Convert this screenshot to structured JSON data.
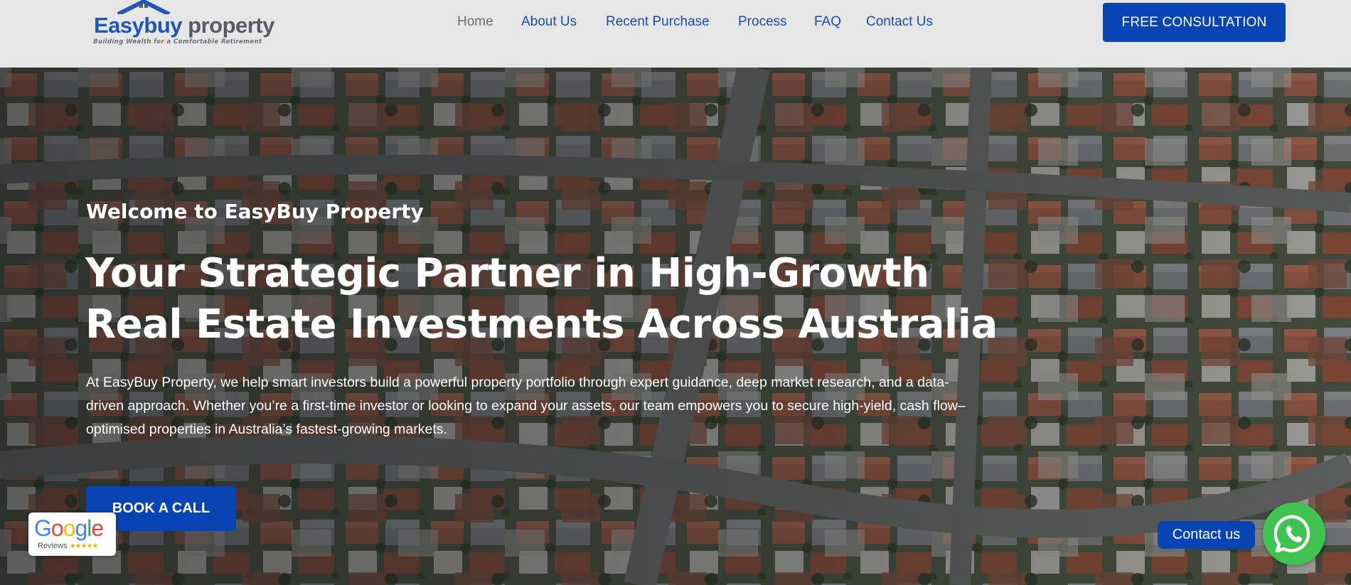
{
  "header": {
    "logo": {
      "brand_part1": "Easybuy",
      "brand_part2": " property",
      "tagline": "Building Wealth for a Comfortable Retirement"
    },
    "nav": [
      {
        "label": "Home",
        "active": true
      },
      {
        "label": "About Us",
        "active": false
      },
      {
        "label": "Recent Purchase",
        "active": false
      },
      {
        "label": "Process",
        "active": false
      },
      {
        "label": "FAQ",
        "active": false
      },
      {
        "label": "Contact Us",
        "active": false
      }
    ],
    "cta_label": "FREE CONSULTATION"
  },
  "hero": {
    "welcome": "Welcome to EasyBuy Property",
    "headline": "Your Strategic Partner in High-Growth Real Estate Investments Across Australia",
    "body": "At EasyBuy Property, we help smart investors build a powerful property portfolio through expert guidance, deep market research, and a data-driven approach. Whether you’re a first-time investor or looking to expand your assets, our team empowers you to secure high-yield, cash flow–optimised properties in Australia’s fastest-growing markets.",
    "button_label": "BOOK A CALL"
  },
  "widgets": {
    "google_badge": {
      "word": "Google",
      "caption": "Reviews",
      "stars": "★★★★★"
    },
    "contact_label": "Contact us",
    "whatsapp_icon": "whatsapp-icon"
  },
  "colors": {
    "brand_blue": "#0844b4",
    "nav_blue": "#1a4ea6",
    "header_bg": "#e6e6e6",
    "whatsapp_green": "#40c351"
  }
}
